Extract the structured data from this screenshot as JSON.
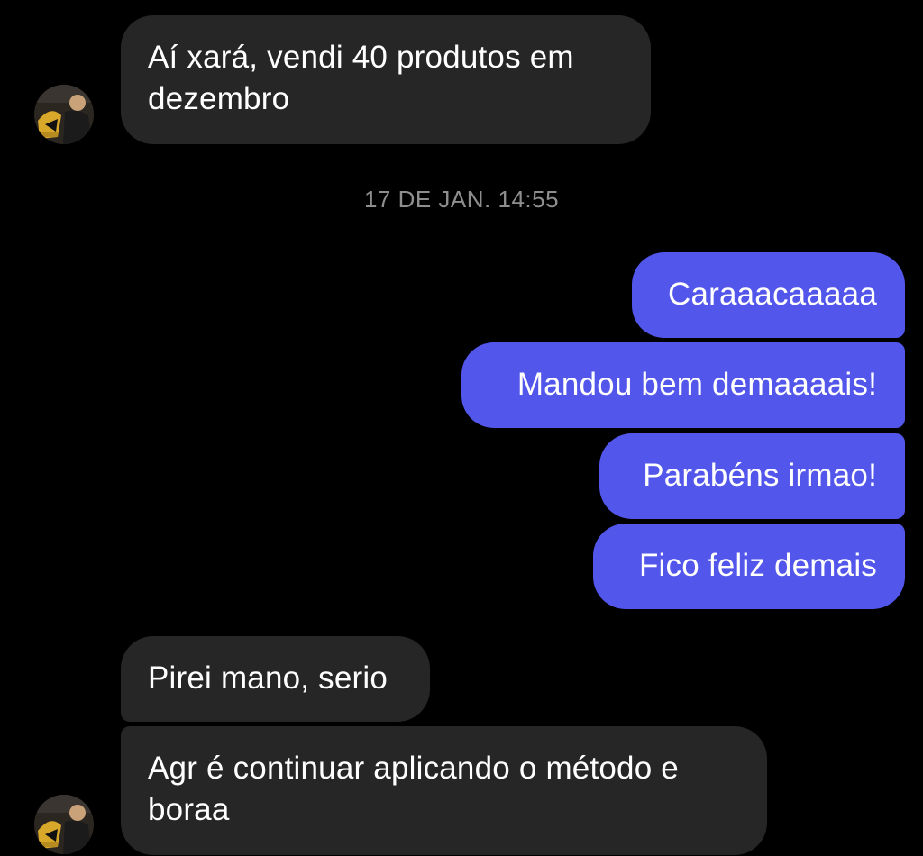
{
  "thread": {
    "messages": [
      {
        "sender": "them",
        "text": "Aí xará, vendi 40 produtos em\ndezembro"
      },
      {
        "sender": "me",
        "text": "Caraaacaaaaa"
      },
      {
        "sender": "me",
        "text": "Mandou bem demaaaais!"
      },
      {
        "sender": "me",
        "text": "Parabéns irmao!"
      },
      {
        "sender": "me",
        "text": "Fico feliz demais"
      },
      {
        "sender": "them",
        "text": "Pirei mano, serio"
      },
      {
        "sender": "them",
        "text": "Agr é continuar aplicando o método e\nboraa"
      }
    ],
    "timestamp": "17 DE JAN. 14:55"
  },
  "colors": {
    "background": "#000000",
    "incoming_bubble": "#262626",
    "outgoing_bubble": "#5356eb",
    "timestamp_text": "#8e8e8e"
  },
  "icons": {
    "avatar": "contact-avatar-photo"
  }
}
